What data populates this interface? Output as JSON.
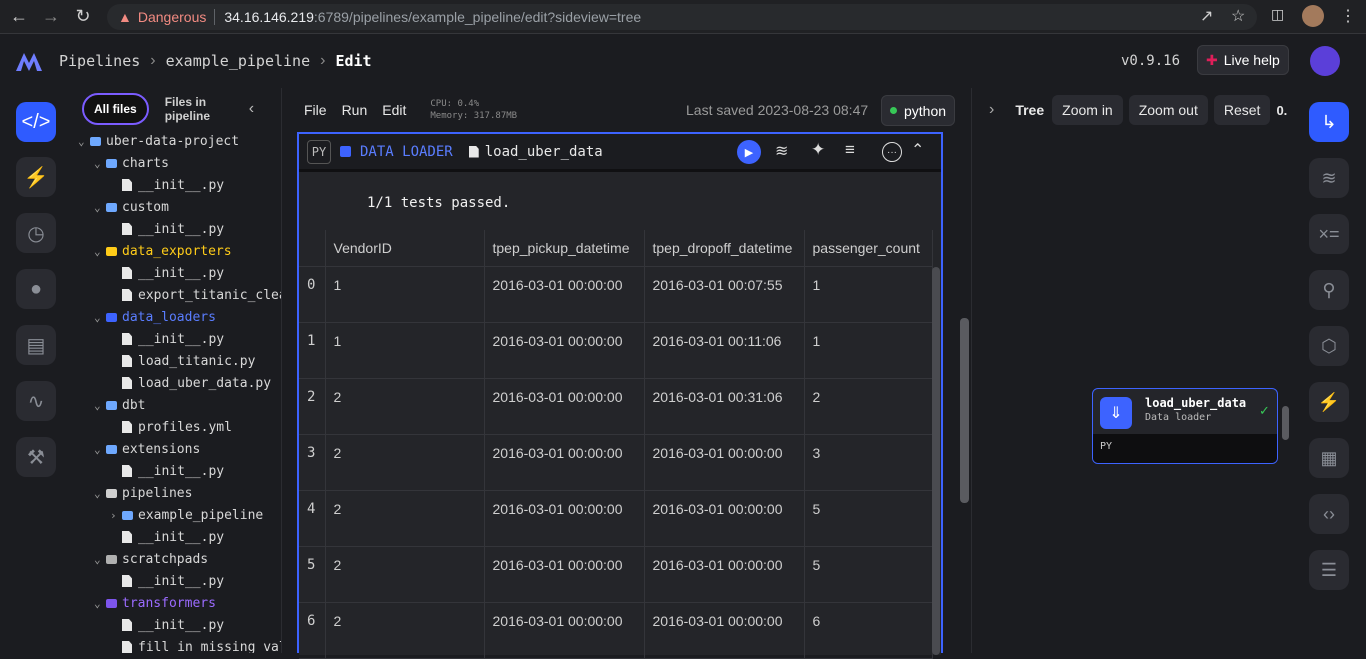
{
  "browser": {
    "security_label": "Dangerous",
    "url_host": "34.16.146.219",
    "url_rest": ":6789/pipelines/example_pipeline/edit?sideview=tree"
  },
  "header": {
    "crumb_pipelines": "Pipelines",
    "crumb_pipeline": "example_pipeline",
    "crumb_edit": "Edit",
    "version": "v0.9.16",
    "live_help": "Live help"
  },
  "filetree": {
    "tab_all": "All files",
    "tab_pipeline": "Files in pipeline",
    "items": [
      {
        "label": "uber-data-project",
        "depth": 0,
        "kind": "folder",
        "color": "#6ea8fe"
      },
      {
        "label": "charts",
        "depth": 1,
        "kind": "folder",
        "color": "#6ea8fe"
      },
      {
        "label": "__init__.py",
        "depth": 2,
        "kind": "file"
      },
      {
        "label": "custom",
        "depth": 1,
        "kind": "folder",
        "color": "#6ea8fe"
      },
      {
        "label": "__init__.py",
        "depth": 2,
        "kind": "file"
      },
      {
        "label": "data_exporters",
        "depth": 1,
        "kind": "folder",
        "color": "#ffcc19",
        "text_color": "#ffcc19"
      },
      {
        "label": "__init__.py",
        "depth": 2,
        "kind": "file"
      },
      {
        "label": "export_titanic_clea",
        "depth": 2,
        "kind": "file"
      },
      {
        "label": "data_loaders",
        "depth": 1,
        "kind": "folder",
        "color": "#3d63ff",
        "text_color": "#5a7dff"
      },
      {
        "label": "__init__.py",
        "depth": 2,
        "kind": "file"
      },
      {
        "label": "load_titanic.py",
        "depth": 2,
        "kind": "file"
      },
      {
        "label": "load_uber_data.py",
        "depth": 2,
        "kind": "file"
      },
      {
        "label": "dbt",
        "depth": 1,
        "kind": "folder",
        "color": "#6ea8fe"
      },
      {
        "label": "profiles.yml",
        "depth": 2,
        "kind": "file"
      },
      {
        "label": "extensions",
        "depth": 1,
        "kind": "folder",
        "color": "#6ea8fe"
      },
      {
        "label": "__init__.py",
        "depth": 2,
        "kind": "file"
      },
      {
        "label": "pipelines",
        "depth": 1,
        "kind": "folder",
        "color": "#cfcfcf"
      },
      {
        "label": "example_pipeline",
        "depth": 2,
        "kind": "folder",
        "color": "#6ea8fe"
      },
      {
        "label": "__init__.py",
        "depth": 2,
        "kind": "file"
      },
      {
        "label": "scratchpads",
        "depth": 1,
        "kind": "folder",
        "color": "#b0b0b0"
      },
      {
        "label": "__init__.py",
        "depth": 2,
        "kind": "file"
      },
      {
        "label": "transformers",
        "depth": 1,
        "kind": "folder",
        "color": "#7d55ec",
        "text_color": "#9b6bff"
      },
      {
        "label": "__init__.py",
        "depth": 2,
        "kind": "file"
      },
      {
        "label": "fill_in_missing_val",
        "depth": 2,
        "kind": "file"
      }
    ]
  },
  "editor": {
    "menu_file": "File",
    "menu_run": "Run",
    "menu_edit": "Edit",
    "cpu": "CPU: 0.4%",
    "memory": "Memory: 317.87MB",
    "last_saved": "Last saved 2023-08-23 08:47",
    "kernel": "python"
  },
  "block": {
    "lang": "PY",
    "type_label": "DATA LOADER",
    "name": "load_uber_data",
    "test_result": "1/1 tests passed.",
    "columns": [
      "",
      "VendorID",
      "tpep_pickup_datetime",
      "tpep_dropoff_datetime",
      "passenger_count"
    ],
    "rows": [
      [
        "0",
        "1",
        "2016-03-01 00:00:00",
        "2016-03-01 00:07:55",
        "1"
      ],
      [
        "1",
        "1",
        "2016-03-01 00:00:00",
        "2016-03-01 00:11:06",
        "1"
      ],
      [
        "2",
        "2",
        "2016-03-01 00:00:00",
        "2016-03-01 00:31:06",
        "2"
      ],
      [
        "3",
        "2",
        "2016-03-01 00:00:00",
        "2016-03-01 00:00:00",
        "3"
      ],
      [
        "4",
        "2",
        "2016-03-01 00:00:00",
        "2016-03-01 00:00:00",
        "5"
      ],
      [
        "5",
        "2",
        "2016-03-01 00:00:00",
        "2016-03-01 00:00:00",
        "5"
      ],
      [
        "6",
        "2",
        "2016-03-01 00:00:00",
        "2016-03-01 00:00:00",
        "6"
      ]
    ]
  },
  "tree": {
    "label": "Tree",
    "zoom_in": "Zoom in",
    "zoom_out": "Zoom out",
    "reset": "Reset",
    "zoom_value": "0.",
    "node_name": "load_uber_data",
    "node_type": "Data loader",
    "node_lang": "PY"
  },
  "colors": {
    "accent": "#3d63ff",
    "purple": "#7b5cff",
    "success": "#37c857",
    "danger": "#f28b82"
  }
}
